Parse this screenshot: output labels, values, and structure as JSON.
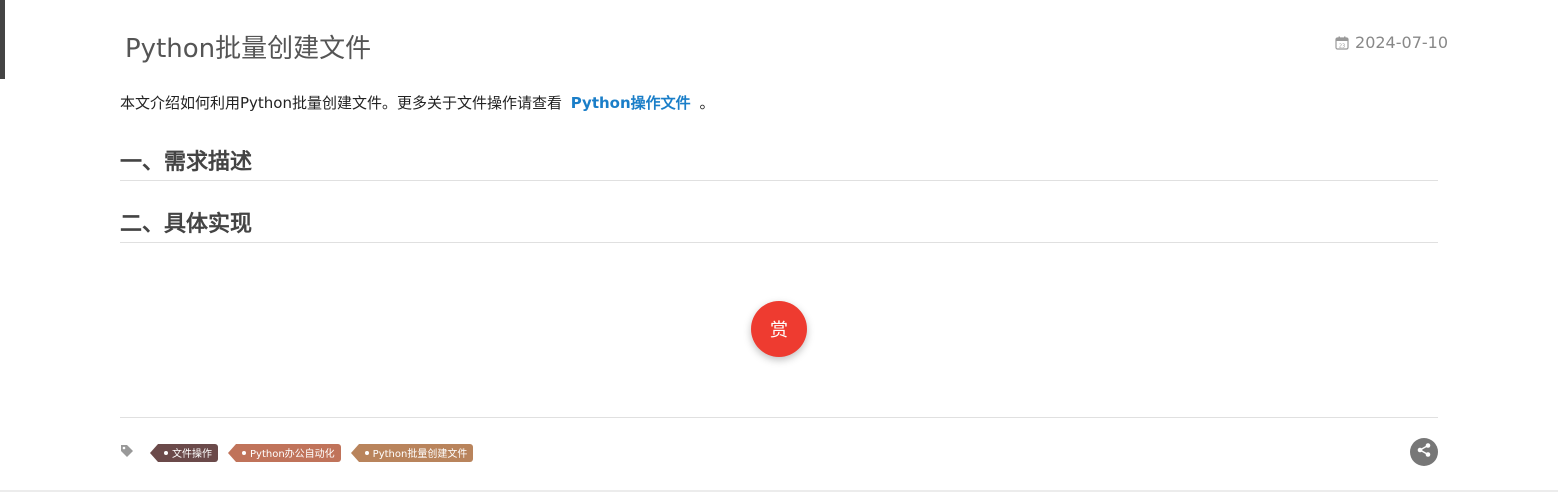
{
  "post": {
    "title": "Python批量创建文件",
    "date": "2024-07-10",
    "intro_before": "本文介绍如何利用Python批量创建文件。更多关于文件操作请查看",
    "intro_link": "Python操作文件",
    "intro_after": "。",
    "sections": [
      {
        "heading": "一、需求描述"
      },
      {
        "heading": "二、具体实现"
      }
    ]
  },
  "reward": {
    "label": "赏",
    "color": "#ee3b30"
  },
  "tags": {
    "icon": "tag-icon",
    "items": [
      {
        "label": "文件操作",
        "color": "#6b4a4a"
      },
      {
        "label": "Python办公自动化",
        "color": "#c0735a"
      },
      {
        "label": "Python批量创建文件",
        "color": "#b9845c"
      }
    ]
  },
  "share": {
    "icon": "share-icon"
  },
  "colors": {
    "link": "#1a7ec8",
    "heading": "#444444",
    "title": "#555555"
  }
}
